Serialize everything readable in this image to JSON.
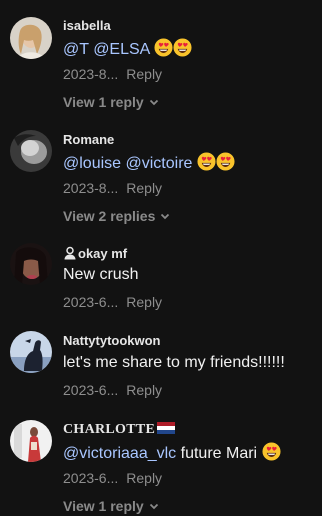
{
  "comments": [
    {
      "username": "isabella",
      "mention_1": "@T",
      "mention_2": "@ELSA",
      "emoji_icons": [
        "heart-eyes-emoji",
        "heart-eyes-emoji"
      ],
      "date": "2023-8...",
      "reply_label": "Reply",
      "view_replies": "View 1 reply"
    },
    {
      "username": "Romane",
      "mention_1": "@louise",
      "mention_2": "@victoire",
      "emoji_icons": [
        "heart-eyes-emoji",
        "heart-eyes-emoji"
      ],
      "date": "2023-8...",
      "reply_label": "Reply",
      "view_replies": "View 2 replies"
    },
    {
      "username": "okay mf",
      "username_icon": "person-icon",
      "text": "New crush",
      "date": "2023-6...",
      "reply_label": "Reply"
    },
    {
      "username": "Nattytytookwon",
      "text": "let's me share to my friends!!!!!!",
      "date": "2023-6...",
      "reply_label": "Reply"
    },
    {
      "username": "CHARLOTTE",
      "username_icon": "netherlands-flag-icon",
      "mention_1": "@victoriaaa_vlc",
      "text": "future Mari",
      "emoji_icons": [
        "heart-eyes-emoji"
      ],
      "date": "2023-6...",
      "reply_label": "Reply",
      "view_replies": "View 1 reply"
    }
  ],
  "colors": {
    "background": "#121212",
    "mention": "#a9c6ff",
    "muted": "#8e8e8e"
  }
}
